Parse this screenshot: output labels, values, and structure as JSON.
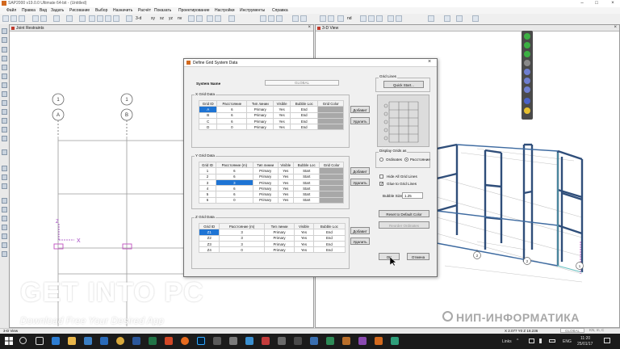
{
  "window": {
    "title": "SAP2000 v19.0.0 Ultimate 64-bit - (Untitled)"
  },
  "menu": [
    "Файл",
    "Правка",
    "Вид",
    "Задать",
    "Рисование",
    "Выбор",
    "Назначить",
    "Расчёт",
    "Показать",
    "Проектирование",
    "Настройки",
    "Инструменты",
    "Справка"
  ],
  "toolbar": {
    "xy": "xy",
    "xz": "xz",
    "yz": "yz",
    "nv": "nv",
    "threed": "3-d",
    "nd": "nd"
  },
  "left_pane": {
    "title": "Joint Restraints",
    "bubbles": [
      "1",
      "A",
      "1",
      "B"
    ],
    "axis_x": "X",
    "axis_z": "Z"
  },
  "right_pane": {
    "title": "3-D View",
    "bubbles": [
      "2",
      "2",
      "1"
    ]
  },
  "dialog": {
    "title": "Define Grid System Data",
    "system_name_label": "System Name",
    "system_name_value": "GLOBAL",
    "x_grid": {
      "title": "X Grid Data",
      "headers": [
        "Grid ID",
        "Расстояние",
        "Тип линии",
        "Visible",
        "Bubble Loc",
        "Grid Color"
      ],
      "rows": [
        [
          "A",
          "6",
          "Primary",
          "Yes",
          "End"
        ],
        [
          "B",
          "6",
          "Primary",
          "Yes",
          "End"
        ],
        [
          "C",
          "6",
          "Primary",
          "Yes",
          "End"
        ],
        [
          "D",
          "0",
          "Primary",
          "Yes",
          "End"
        ]
      ]
    },
    "y_grid": {
      "title": "Y Grid Data",
      "headers": [
        "Grid ID",
        "Расстояние (m)",
        "Тип линии",
        "Visible",
        "Bubble Loc",
        "Grid Color"
      ],
      "rows": [
        [
          "1",
          "6",
          "Primary",
          "Yes",
          "Start"
        ],
        [
          "2",
          "6",
          "Primary",
          "Yes",
          "Start"
        ],
        [
          "3",
          "3",
          "Primary",
          "Yes",
          "Start"
        ],
        [
          "4",
          "6",
          "Primary",
          "Yes",
          "Start"
        ],
        [
          "5",
          "6",
          "Primary",
          "Yes",
          "Start"
        ],
        [
          "6",
          "0",
          "Primary",
          "Yes",
          "Start"
        ]
      ]
    },
    "z_grid": {
      "title": "Z Grid Data",
      "headers": [
        "Grid ID",
        "Расстояние (m)",
        "Тип линии",
        "Visible",
        "Bubble Loc"
      ],
      "rows": [
        [
          "Z1",
          "3",
          "Primary",
          "Yes",
          "End"
        ],
        [
          "Z2",
          "3",
          "Primary",
          "Yes",
          "End"
        ],
        [
          "Z3",
          "3",
          "Primary",
          "Yes",
          "End"
        ],
        [
          "Z4",
          "0",
          "Primary",
          "Yes",
          "End"
        ]
      ]
    },
    "add_label": "Добавит",
    "delete_label": "Удалить",
    "grid_lines_title": "Grid Lines",
    "quick_start_label": "Quick Start...",
    "display_grids_title": "Display Grids as",
    "ordinates_label": "Ordinates",
    "spacing_label": "Расстояние",
    "hide_all_label": "Hide All Grid Lines",
    "glue_label": "Glue to Grid Lines",
    "bubble_size_label": "Bubble Size",
    "bubble_size_value": "1.25",
    "reset_color_label": "Reset to Default Color",
    "reorder_label": "Reorder Ordinates",
    "ok_label": "OK",
    "cancel_label": "Отмена"
  },
  "watermark": {
    "line1a": "GET ",
    "line1b": "INTO PC",
    "line2": "Download Free Your Desired App",
    "brand": "НИП-ИНФОРМАТИКА"
  },
  "status": {
    "view": "3-D View",
    "coords": "X 2.077  Y0  Z 18.236",
    "cs": "GLOBAL",
    "units": "KN, m, C"
  },
  "taskbar": {
    "tray": "Links",
    "lang": "ENG",
    "time": "11:20",
    "date": "25/01/17"
  },
  "colors": {
    "accent": "#1e74d4",
    "frame": "#2f4e7a",
    "taskbar": "#1b1b1b"
  }
}
